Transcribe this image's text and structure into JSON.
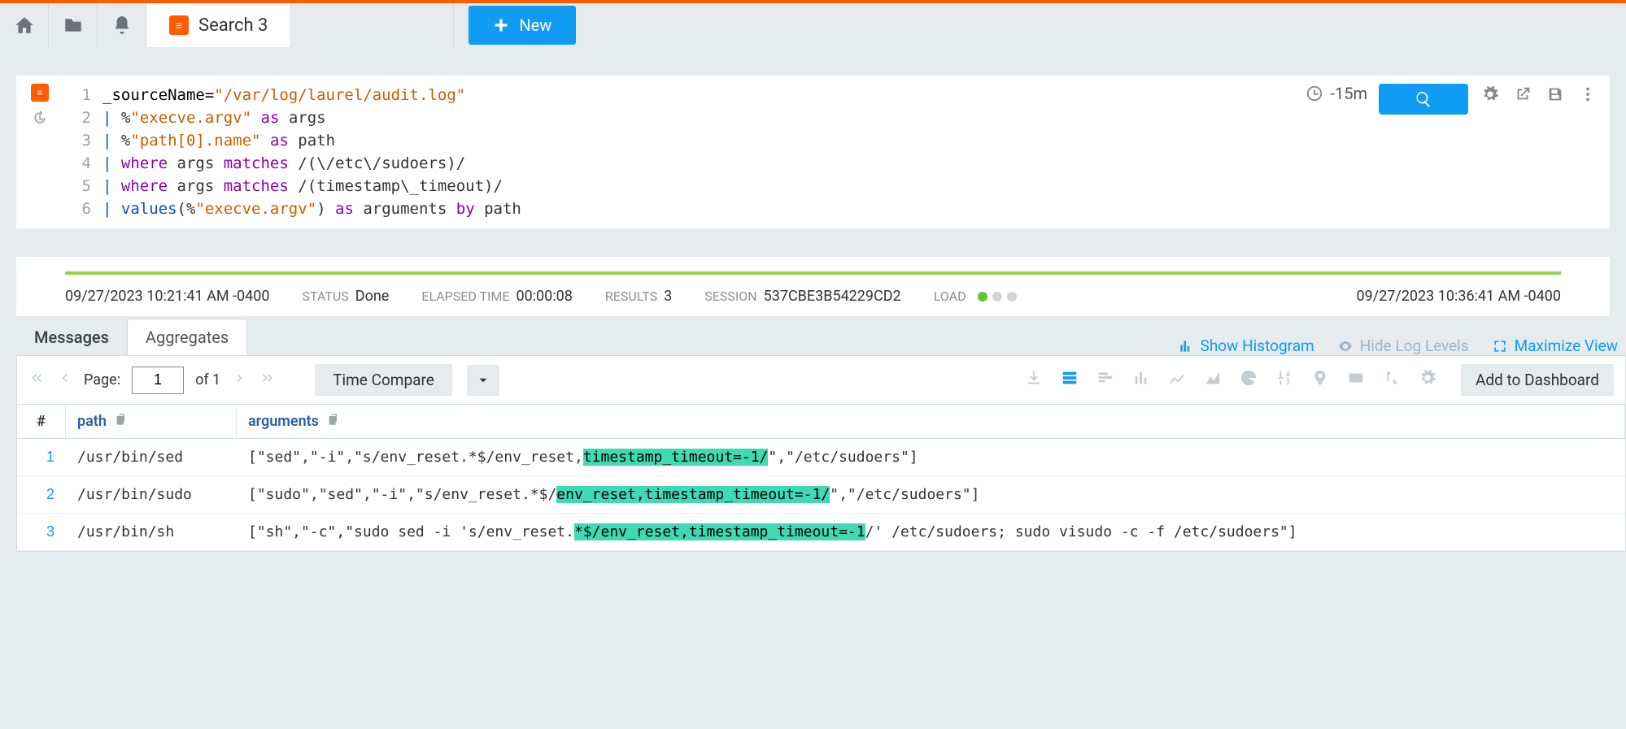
{
  "topbar": {
    "tab_title": "Search 3",
    "new_label": "New"
  },
  "query": {
    "lines": [
      "1",
      "2",
      "3",
      "4",
      "5",
      "6"
    ],
    "line1_prop": "_sourceName=",
    "line1_str": "\"/var/log/laurel/audit.log\"",
    "line2_pipe": "|",
    "line2_pct": " %",
    "line2_str": "\"execve.argv\"",
    "line2_as": " as ",
    "line2_id": "args",
    "line3_pipe": "|",
    "line3_pct": " %",
    "line3_str": "\"path[0].name\"",
    "line3_as": " as ",
    "line3_id": "path",
    "line4_pipe": "|",
    "line4_kw1": " where ",
    "line4_id1": "args ",
    "line4_kw2": "matches ",
    "line4_re": "/(\\/etc\\/sudoers)/",
    "line5_pipe": "|",
    "line5_kw1": " where ",
    "line5_id1": "args ",
    "line5_kw2": "matches ",
    "line5_re": "/(timestamp\\_timeout)/",
    "line6_pipe": "|",
    "line6_func": " values",
    "line6_open": "(%",
    "line6_str": "\"execve.argv\"",
    "line6_close": ") ",
    "line6_as": "as ",
    "line6_id1": "arguments ",
    "line6_by": "by ",
    "line6_id2": "path"
  },
  "time_range": "-15m",
  "status": {
    "start_time": "09/27/2023 10:21:41 AM -0400",
    "end_time": "09/27/2023 10:36:41 AM -0400",
    "status_label": "STATUS",
    "status_value": "Done",
    "elapsed_label": "ELAPSED TIME",
    "elapsed_value": "00:00:08",
    "results_label": "RESULTS",
    "results_value": "3",
    "session_label": "SESSION",
    "session_value": "537CBE3B54229CD2",
    "load_label": "LOAD"
  },
  "tabs": {
    "messages": "Messages",
    "aggregates": "Aggregates"
  },
  "view_actions": {
    "show_histogram": "Show Histogram",
    "hide_log_levels": "Hide Log Levels",
    "maximize": "Maximize View"
  },
  "pager": {
    "page_label": "Page:",
    "page_value": "1",
    "page_of": "of 1",
    "time_compare": "Time Compare",
    "add_dashboard": "Add to Dashboard"
  },
  "table": {
    "col_num": "#",
    "col_path": "path",
    "col_args": "arguments",
    "rows": [
      {
        "n": "1",
        "path": "/usr/bin/sed",
        "args_pre": "[\"sed\",\"-i\",\"s/env_reset.*$/env_reset,",
        "args_hl": "timestamp_timeout=-1/",
        "args_post": "\",\"/etc/sudoers\"]"
      },
      {
        "n": "2",
        "path": "/usr/bin/sudo",
        "args_pre": "[\"sudo\",\"sed\",\"-i\",\"s/env_reset.*$/",
        "args_hl": "env_reset,timestamp_timeout=-1/",
        "args_post": "\",\"/etc/sudoers\"]"
      },
      {
        "n": "3",
        "path": "/usr/bin/sh",
        "args_pre": "[\"sh\",\"-c\",\"sudo sed -i 's/env_reset.",
        "args_hl": "*$/env_reset,timestamp_timeout=-1",
        "args_post": "/' /etc/sudoers; sudo visudo -c -f /etc/sudoers\"]"
      }
    ]
  }
}
